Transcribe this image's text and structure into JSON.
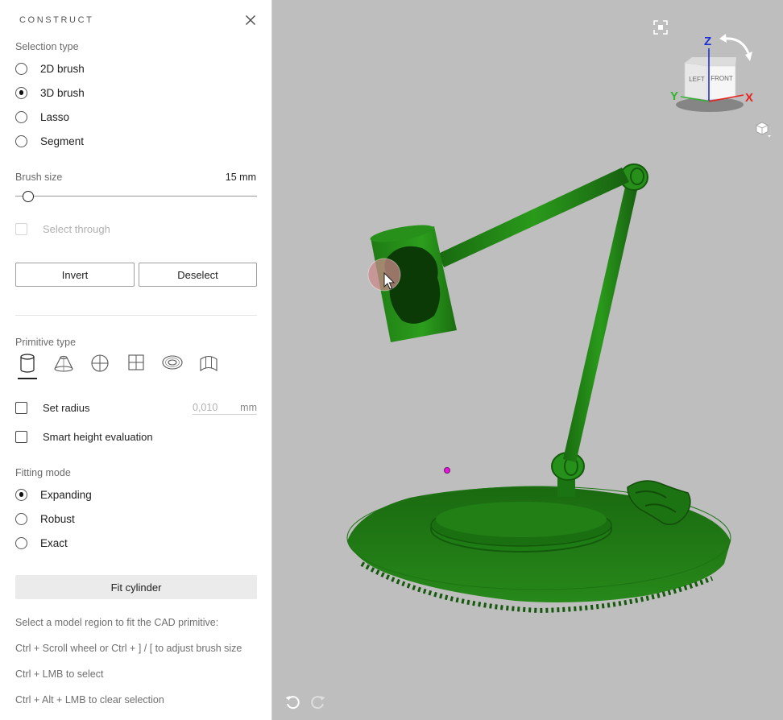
{
  "panel": {
    "title": "CONSTRUCT",
    "selection_type": {
      "label": "Selection type",
      "options": [
        "2D brush",
        "3D brush",
        "Lasso",
        "Segment"
      ],
      "selected": "3D brush"
    },
    "brush_size": {
      "label": "Brush size",
      "value_text": "15 mm",
      "fraction": 0.03
    },
    "select_through": {
      "label": "Select through",
      "checked": false,
      "enabled": false
    },
    "buttons": {
      "invert": "Invert",
      "deselect": "Deselect"
    },
    "primitive_type": {
      "label": "Primitive type",
      "items": [
        "cylinder-icon",
        "cone-icon",
        "sphere-icon",
        "plane-icon",
        "torus-icon",
        "surface-icon"
      ],
      "selected": "cylinder-icon"
    },
    "set_radius": {
      "label": "Set radius",
      "checked": false,
      "value": "0,010",
      "unit": "mm"
    },
    "smart_height": {
      "label": "Smart height evaluation",
      "checked": false
    },
    "fitting_mode": {
      "label": "Fitting mode",
      "options": [
        "Expanding",
        "Robust",
        "Exact"
      ],
      "selected": "Expanding"
    },
    "fit_button": "Fit cylinder",
    "help": [
      "Select a model region to fit the CAD primitive:",
      "Ctrl + Scroll wheel or Ctrl + ] / [ to adjust brush size",
      "Ctrl + LMB to select",
      "Ctrl + Alt + LMB to clear selection"
    ]
  },
  "viewport": {
    "background": "#bebebe",
    "model_color": "#1f7a14",
    "axes": {
      "x": "X",
      "y": "Y",
      "z": "Z"
    },
    "cube_faces": {
      "left": "LEFT",
      "front": "FRONT"
    },
    "axis_colors": {
      "x": "#e8231f",
      "y": "#2fb52f",
      "z": "#1d2fd6"
    }
  }
}
